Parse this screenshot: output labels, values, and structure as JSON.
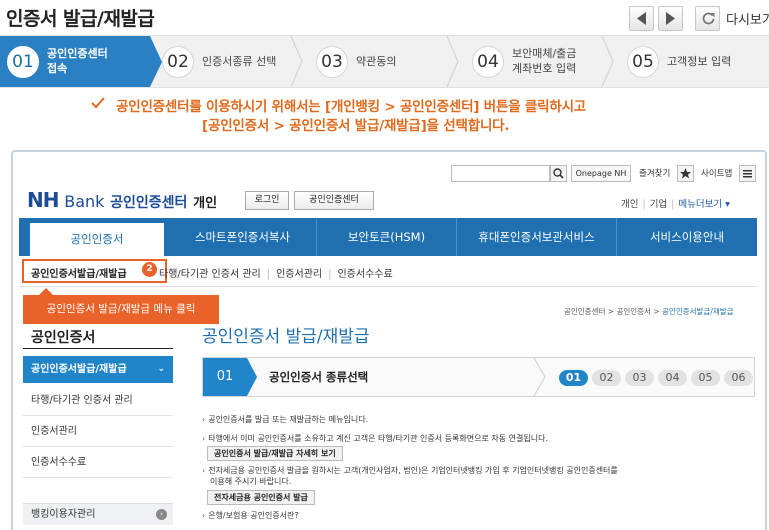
{
  "page": {
    "title": "인증서 발급/재발급",
    "replay_label": "다시보기"
  },
  "icons": {
    "prev": "chevron-left-icon",
    "next": "chevron-right-icon",
    "replay": "refresh-icon",
    "check": "check-icon",
    "search": "search-icon",
    "star": "star-icon",
    "sitemap": "menu-icon"
  },
  "colors": {
    "accent_blue": "#2b7fc3",
    "notice_orange": "#e06a1d",
    "highlight_orange": "#e8622a",
    "nav_blue": "#1f6fb1"
  },
  "steps": [
    {
      "num": "01",
      "label_line1": "공인인증센터",
      "label_line2": "접속",
      "active": true
    },
    {
      "num": "02",
      "label_line1": "인증서종류 선택",
      "label_line2": ""
    },
    {
      "num": "03",
      "label_line1": "약관동의",
      "label_line2": ""
    },
    {
      "num": "04",
      "label_line1": "보안매체/출금",
      "label_line2": "계좌번호 입력"
    },
    {
      "num": "05",
      "label_line1": "고객정보 입력",
      "label_line2": ""
    }
  ],
  "notice": {
    "line1": "공인인증센터를 이용하시기 위해서는 [개인뱅킹 > 공인인증센터] 버튼을 클릭하시고",
    "line2": "[공인인증서 > 공인인증서 발급/재발급]을 선택합니다."
  },
  "site": {
    "onepage_label": "Onepage NH",
    "fav_label": "즐겨찾기",
    "sitemap_label": "사이트맵",
    "logo_nh": "NH",
    "logo_bank": "Bank",
    "logo_center": "공인인증센터",
    "logo_personal": "개인",
    "login_btn": "로그인",
    "cert_center_btn": "공인인증센터",
    "link_personal": "개인",
    "link_business": "기업",
    "link_more": "메뉴더보기 ▾",
    "nav": [
      "공인인증서",
      "스마트폰인증서복사",
      "보안토큰(HSM)",
      "휴대폰인증서보관서비스",
      "서비스이용안내"
    ],
    "subnav_active": "공인인증서발급/재발급",
    "subnav_badge": "2",
    "subnav": [
      "타행/타기관 인증서 관리",
      "인증서관리",
      "인증서수수료"
    ],
    "tooltip": "공인인증서 발급/재발급 메뉴 클릭",
    "sidebar_title": "공인인증서",
    "sidebar_active": "공인인증서발급/재발급",
    "sidebar_active_chev": "⌄",
    "sidebar_items": [
      "타행/타기관 인증서 관리",
      "인증서관리",
      "인증서수수료"
    ],
    "sidebar_banking": "뱅킹이용자관리",
    "sidebar_banking_arrow": "›",
    "breadcrumb": "공인인증센터 > 공인인증서 > ",
    "breadcrumb_current": "공인인증서발급/재발급",
    "content_title": "공인인증서 발급/재발급",
    "progress_num": "01",
    "progress_label": "공인인증서 종류선택",
    "progress_steps": [
      "01",
      "02",
      "03",
      "04",
      "05",
      "06"
    ],
    "body_1": "공인인증서를 발급 또는 재발급하는 메뉴입니다.",
    "body_2": "타행에서 이미 공인인증서를 소유하고 계신 고객은 타행/타기관 인증서 등록화면으로 자동 연결됩니다.",
    "btn_detail": "공인인증서 발급/재발급 자세히 보기",
    "body_3": "전자세금용 공인인증서 발급을 원하시는 고객(개인사업자, 법인)은 기업인터넷뱅킹 가입 후 기업인터넷뱅킹 공인인증센터를",
    "body_3b": "이용해 주시기 바랍니다.",
    "btn_etax": "전자세금용 공인인증서 발급",
    "body_4": "은행/보험용 공인인증서란?"
  }
}
